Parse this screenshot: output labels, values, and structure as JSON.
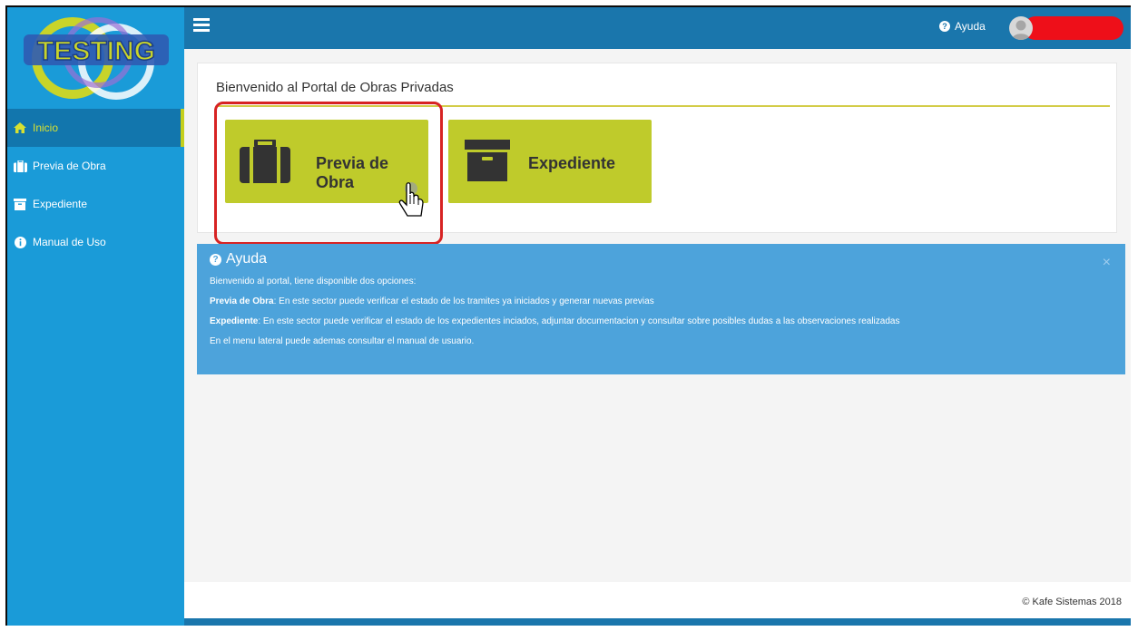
{
  "logo": {
    "text": "TESTING"
  },
  "sidebar": {
    "items": [
      {
        "label": "Inicio",
        "icon": "home-icon",
        "active": true
      },
      {
        "label": "Previa de Obra",
        "icon": "briefcase-icon",
        "active": false
      },
      {
        "label": "Expediente",
        "icon": "archive-icon",
        "active": false
      },
      {
        "label": "Manual de Uso",
        "icon": "info-icon",
        "active": false
      }
    ]
  },
  "topbar": {
    "menu_icon": "hamburger-icon",
    "help_label": "Ayuda",
    "help_icon": "question-circle-icon",
    "avatar_icon": "user-avatar"
  },
  "welcome": {
    "title": "Bienvenido al Portal de Obras Privadas",
    "tiles": [
      {
        "label": "Previa de Obra",
        "icon": "briefcase-icon"
      },
      {
        "label": "Expediente",
        "icon": "archive-icon"
      }
    ]
  },
  "help_panel": {
    "title": "Ayuda",
    "close": "×",
    "intro": "Bienvenido al portal, tiene disponible dos opciones:",
    "previa_label": "Previa de Obra",
    "previa_text": ": En este sector puede verificar el estado de los tramites ya iniciados y generar nuevas previas",
    "expediente_label": "Expediente",
    "expediente_text": ": En este sector puede verificar el estado de los expedientes inciados, adjuntar documentacion y consultar sobre posibles dudas a las observaciones realizadas",
    "menu_note": "En el menu lateral puede ademas consultar el manual de usuario."
  },
  "footer": {
    "text": "© Kafe Sistemas 2018"
  },
  "colors": {
    "sidebar": "#1a9bd8",
    "topbar": "#1a76ac",
    "tile": "#bfcb2b",
    "help_panel": "#4da3db",
    "highlight": "#d72323",
    "active_text": "#d6e032"
  }
}
